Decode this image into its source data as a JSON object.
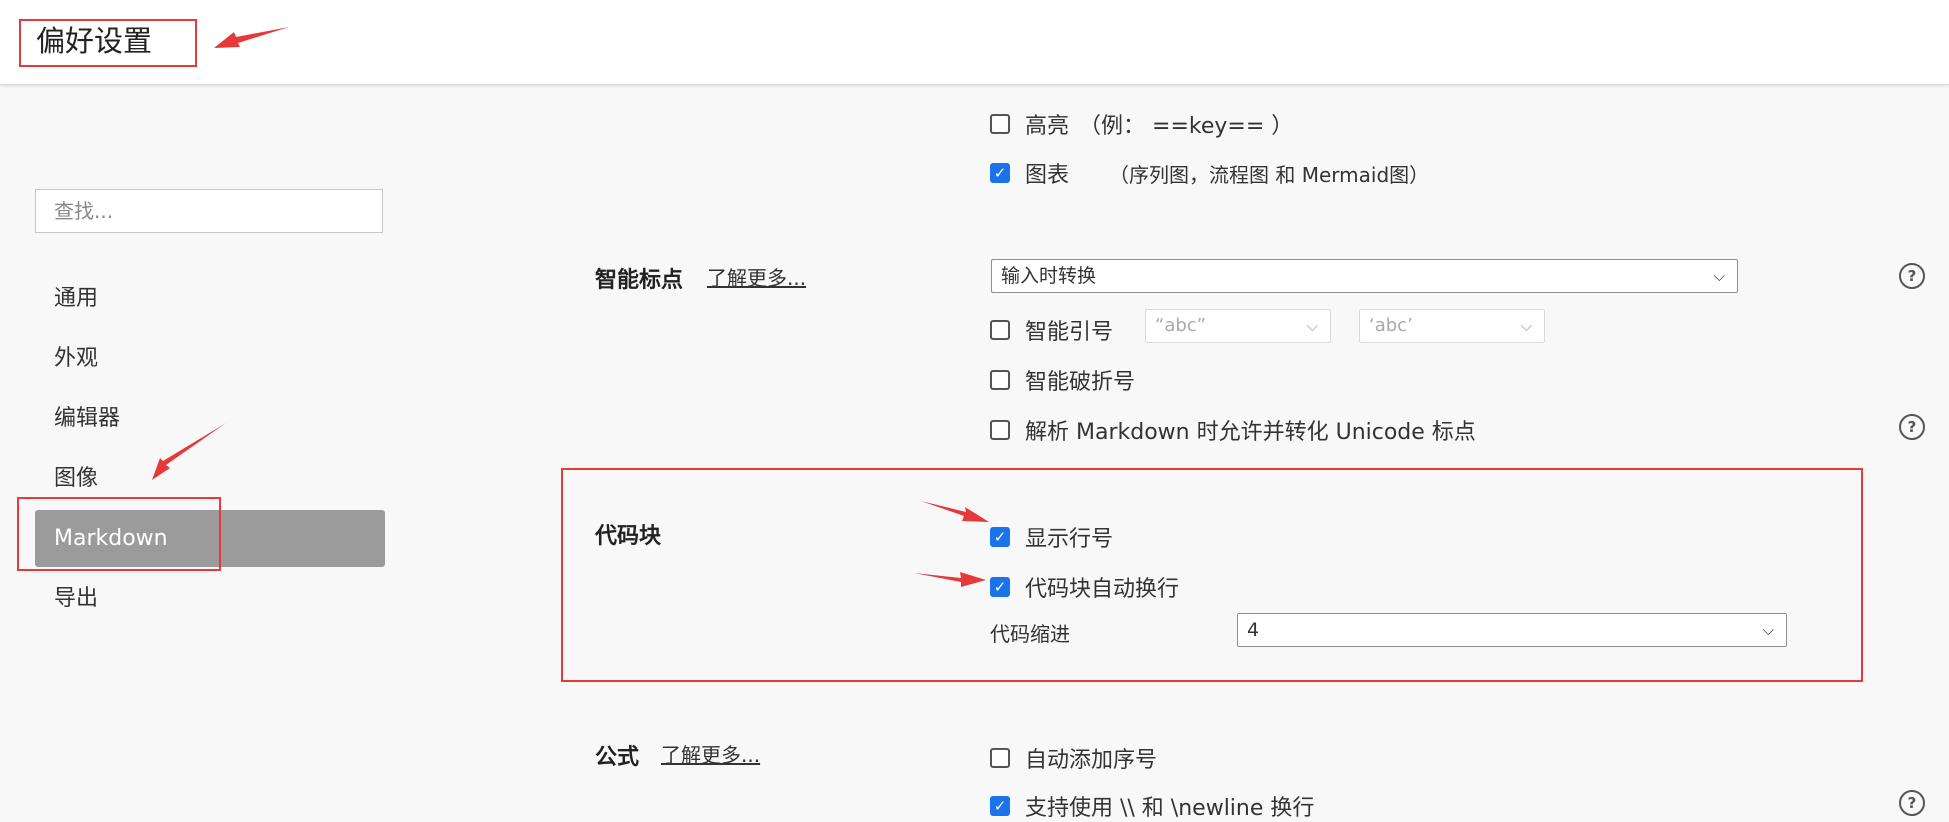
{
  "window": {
    "title": "偏好设置"
  },
  "sidebar": {
    "search_placeholder": "查找...",
    "items": [
      {
        "label": "通用"
      },
      {
        "label": "外观"
      },
      {
        "label": "编辑器"
      },
      {
        "label": "图像"
      },
      {
        "label": "Markdown",
        "active": true
      },
      {
        "label": "导出"
      }
    ]
  },
  "syntax": {
    "highlight": {
      "label": "高亮",
      "hint": "（例： ==key== ）",
      "checked": false
    },
    "diagrams": {
      "label": "图表",
      "hint": "（序列图，流程图 和 Mermaid图）",
      "checked": true
    }
  },
  "smart_punctuation": {
    "title": "智能标点",
    "learn_more": "了解更多...",
    "mode_select": "输入时转换",
    "smart_quotes": {
      "label": "智能引号",
      "checked": false,
      "double_option": "“abc”",
      "single_option": "‘abc’"
    },
    "smart_dashes": {
      "label": "智能破折号",
      "checked": false
    },
    "unicode_punct": {
      "label": "解析 Markdown 时允许并转化 Unicode 标点",
      "checked": false
    }
  },
  "code_block": {
    "title": "代码块",
    "show_line_numbers": {
      "label": "显示行号",
      "checked": true
    },
    "wrap_lines": {
      "label": "代码块自动换行",
      "checked": true
    },
    "indent_label": "代码缩进",
    "indent_value": "4"
  },
  "math": {
    "title": "公式",
    "learn_more": "了解更多...",
    "auto_numbering": {
      "label": "自动添加序号",
      "checked": false
    },
    "newline": {
      "label": "支持使用 \\\\ 和 \\newline 换行",
      "checked": true
    }
  },
  "icons": {
    "checkmark": "✓",
    "chevron": "⌵",
    "help": "?"
  },
  "colors": {
    "accent": "#1a73e8",
    "annotation": "#e5393a",
    "active_nav": "#9b9b9b"
  }
}
